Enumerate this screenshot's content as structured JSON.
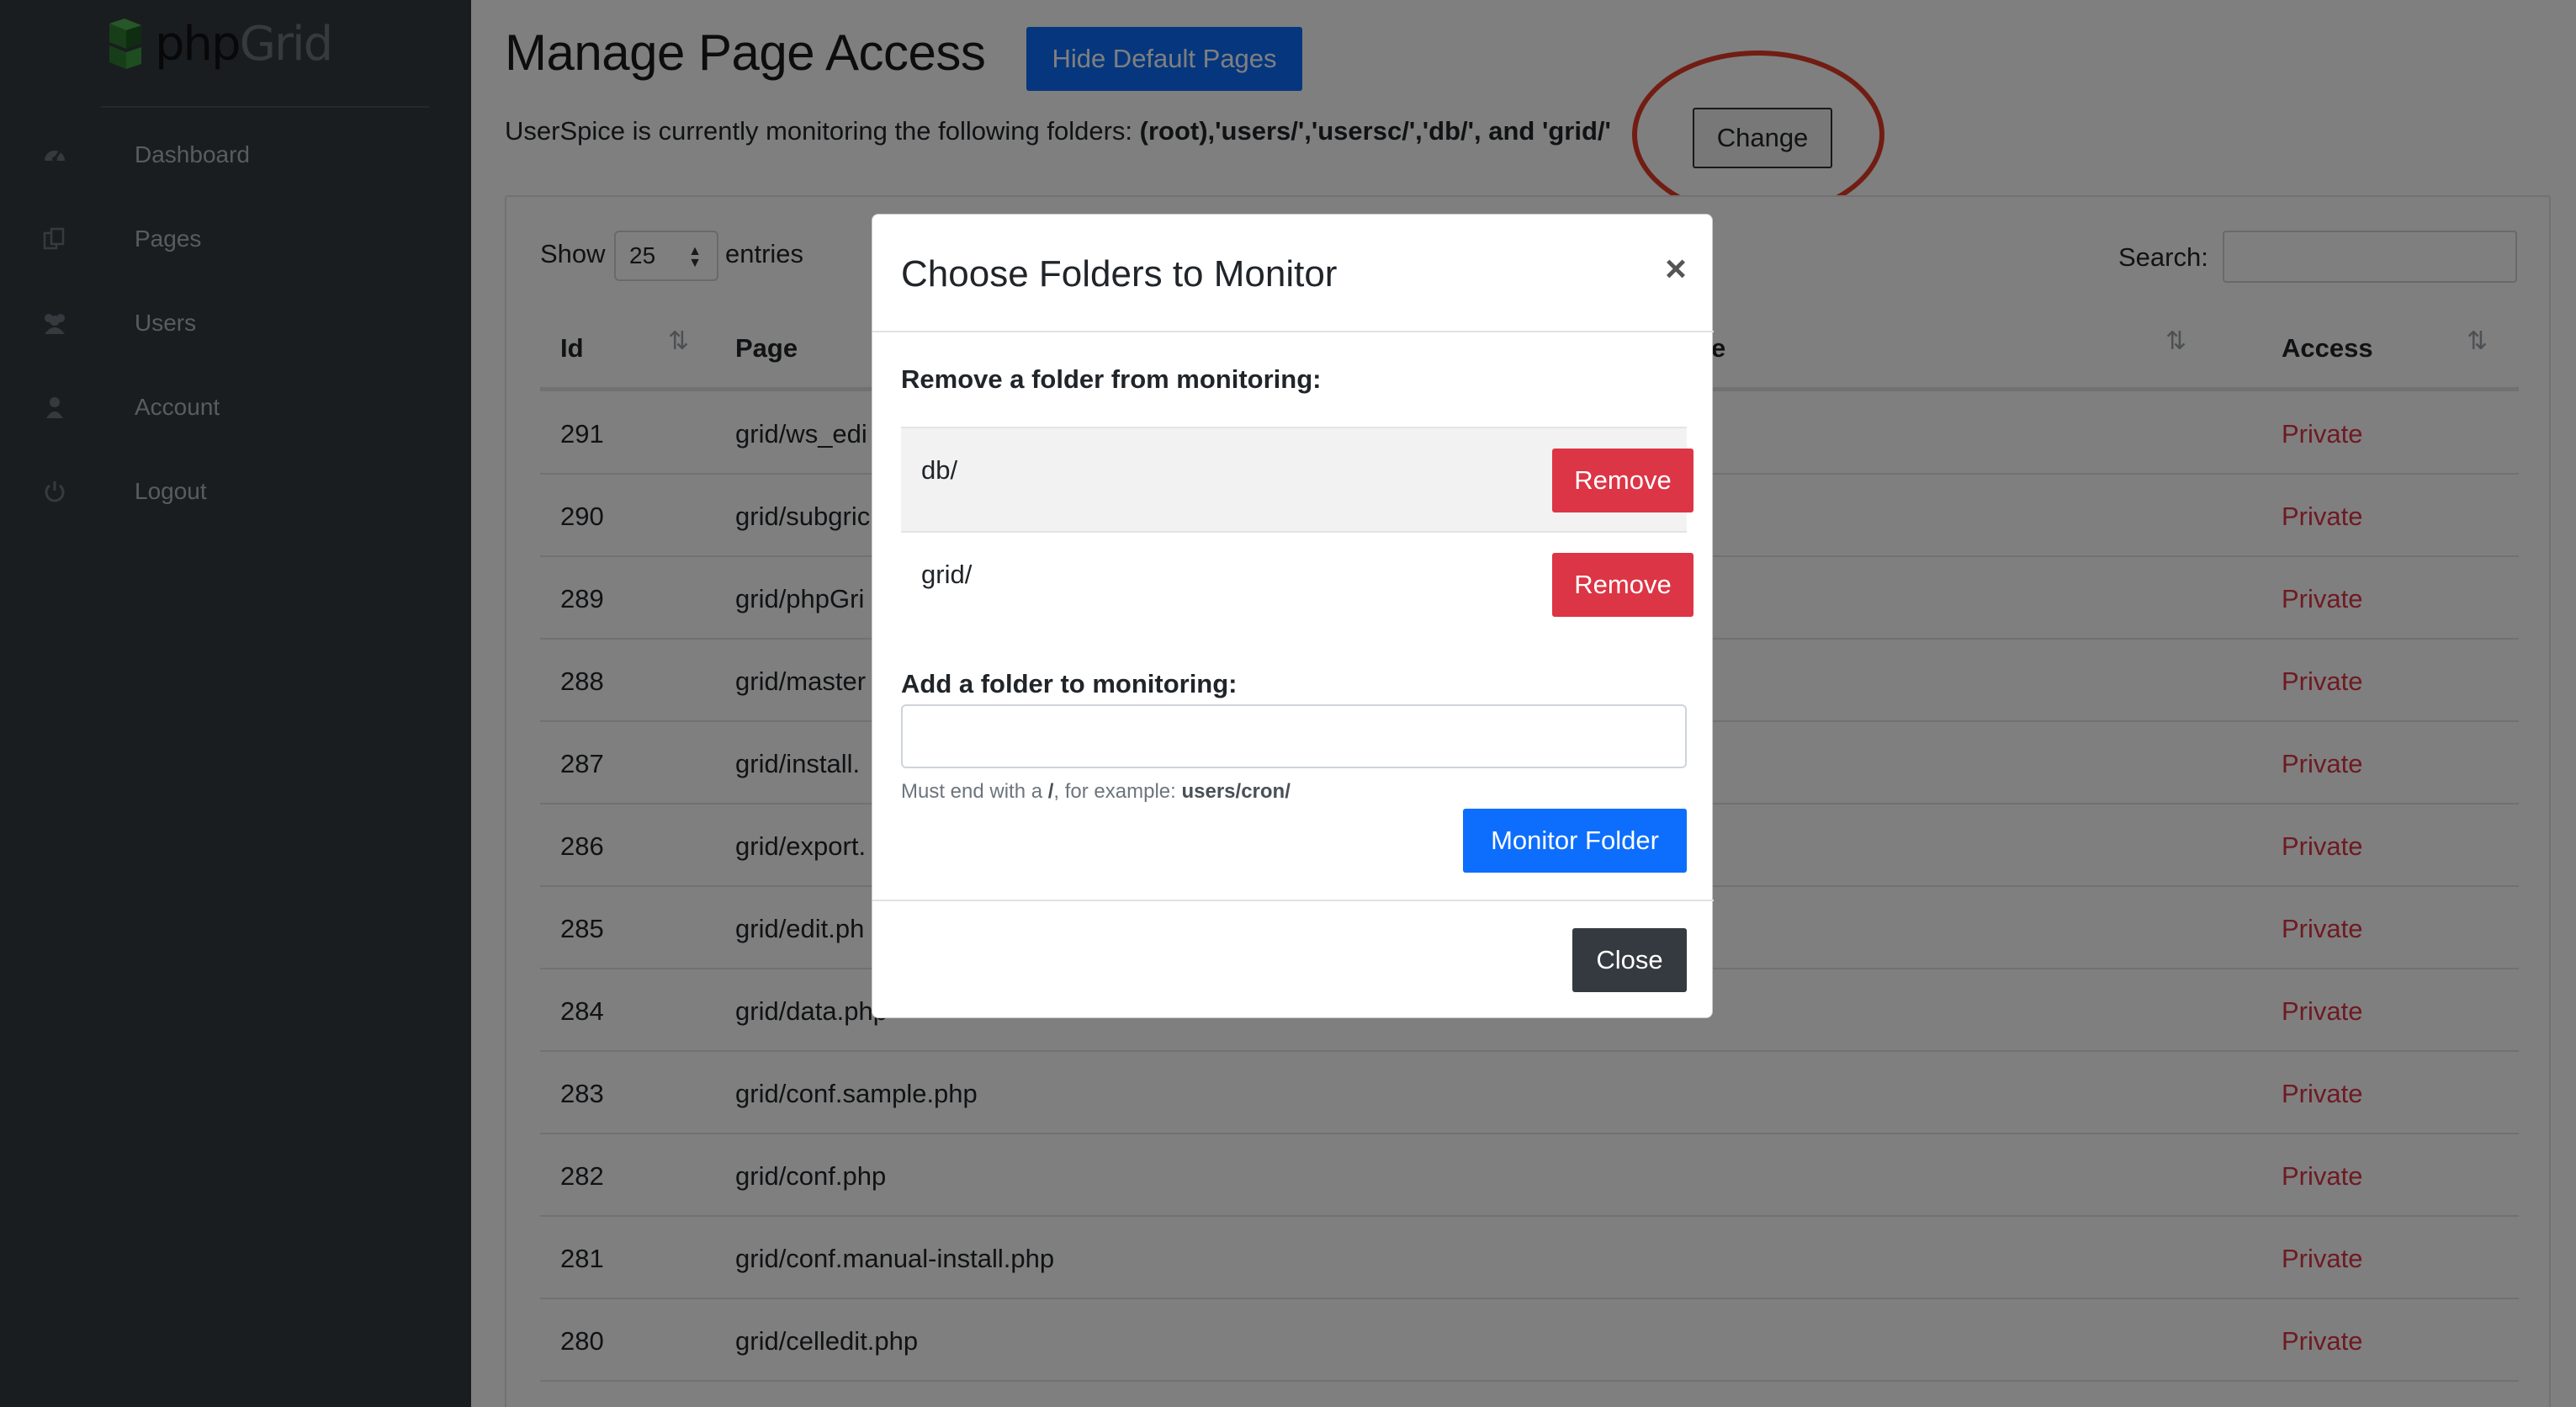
{
  "brand": {
    "part1": "php",
    "part2": "Grid"
  },
  "sidebar": {
    "items": [
      {
        "label": "Dashboard",
        "icon": "dashboard-icon"
      },
      {
        "label": "Pages",
        "icon": "pages-icon"
      },
      {
        "label": "Users",
        "icon": "users-icon"
      },
      {
        "label": "Account",
        "icon": "account-icon"
      },
      {
        "label": "Logout",
        "icon": "power-icon"
      }
    ]
  },
  "page": {
    "title": "Manage Page Access",
    "hide_default_label": "Hide Default Pages",
    "monitor_prefix": "UserSpice is currently monitoring the following folders: ",
    "monitor_folders": "(root),'users/','usersc/','db/', and 'grid/'",
    "change_label": "Change"
  },
  "table_controls": {
    "show_label": "Show",
    "entries_value": "25",
    "entries_label": "entries",
    "search_label": "Search:"
  },
  "table": {
    "columns": [
      "Id",
      "Page",
      "e",
      "Access"
    ],
    "rows": [
      {
        "id": "291",
        "page": "grid/ws_edi",
        "access": "Private"
      },
      {
        "id": "290",
        "page": "grid/subgric",
        "access": "Private"
      },
      {
        "id": "289",
        "page": "grid/phpGri",
        "access": "Private"
      },
      {
        "id": "288",
        "page": "grid/master",
        "access": "Private"
      },
      {
        "id": "287",
        "page": "grid/install.",
        "access": "Private"
      },
      {
        "id": "286",
        "page": "grid/export.",
        "access": "Private"
      },
      {
        "id": "285",
        "page": "grid/edit.ph",
        "access": "Private"
      },
      {
        "id": "284",
        "page": "grid/data.php",
        "access": "Private"
      },
      {
        "id": "283",
        "page": "grid/conf.sample.php",
        "access": "Private"
      },
      {
        "id": "282",
        "page": "grid/conf.php",
        "access": "Private"
      },
      {
        "id": "281",
        "page": "grid/conf.manual-install.php",
        "access": "Private"
      },
      {
        "id": "280",
        "page": "grid/celledit.php",
        "access": "Private"
      }
    ]
  },
  "modal": {
    "title": "Choose Folders to Monitor",
    "close_x": "×",
    "remove_heading": "Remove a folder from monitoring:",
    "folders": [
      {
        "name": "db/",
        "button": "Remove"
      },
      {
        "name": "grid/",
        "button": "Remove"
      }
    ],
    "add_heading": "Add a folder to monitoring:",
    "input_value": "",
    "help_prefix": "Must end with a ",
    "help_slash": "/",
    "help_middle": ", for example: ",
    "help_example": "users/cron/",
    "monitor_button": "Monitor Folder",
    "close_button": "Close"
  },
  "colors": {
    "sidebar_bg": "#343a40",
    "primary": "#0d6efd",
    "danger": "#dc3545",
    "dark": "#343a40",
    "annotation": "#e33b26",
    "logo_green": "#2f7d32"
  }
}
